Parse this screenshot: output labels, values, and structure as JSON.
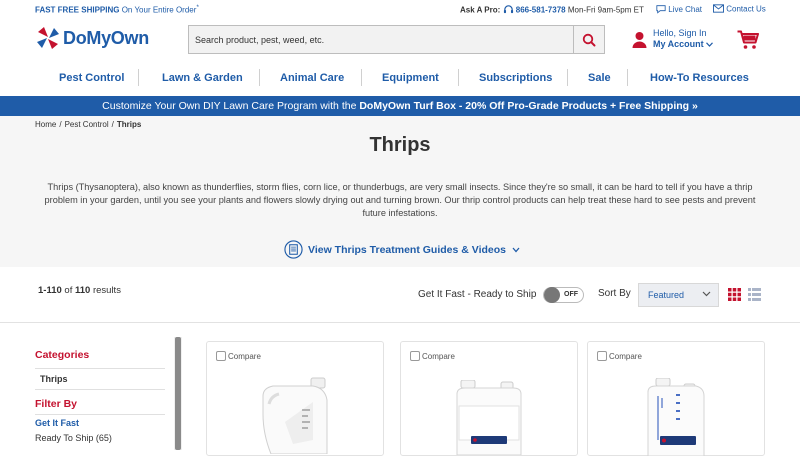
{
  "utility": {
    "shipping_bold": "FAST FREE SHIPPING",
    "shipping_rest": "On Your Entire Order",
    "shipping_mark": "*",
    "ask_label": "Ask A Pro:",
    "phone": "866-581-7378",
    "hours": "Mon-Fri 9am-5pm ET",
    "live_chat": "Live Chat",
    "contact_us": "Contact Us"
  },
  "header": {
    "logo_text": "DoMyOwn",
    "search_placeholder": "Search product, pest, weed, etc.",
    "hello": "Hello, Sign In",
    "my_account": "My Account"
  },
  "nav": {
    "items": [
      "Pest Control",
      "Lawn & Garden",
      "Animal Care",
      "Equipment",
      "Subscriptions",
      "Sale",
      "How-To Resources"
    ]
  },
  "promo": {
    "text_lead": "Customize Your Own DIY Lawn Care Program with the ",
    "text_bold": "DoMyOwn Turf Box - 20% Off Pro-Grade Products + Free Shipping »"
  },
  "breadcrumb": [
    "Home",
    "Pest Control",
    "Thrips"
  ],
  "page": {
    "title": "Thrips",
    "description": "Thrips (Thysanoptera), also known as thunderflies, storm flies, corn lice, or thunderbugs, are very small insects. Since they're so small, it can be hard to tell if you have a thrip problem in your garden, until you see your plants and flowers slowly drying out and turning brown. Our thrip control products can help treat these hard to see pests and prevent future infestations.",
    "guides_link": "View Thrips Treatment Guides & Videos"
  },
  "results": {
    "range": "1-110",
    "of": "of",
    "total": "110",
    "suffix": "results",
    "fast_label": "Get It Fast - Ready to Ship",
    "toggle_state": "OFF",
    "sort_label": "Sort By",
    "sort_value": "Featured"
  },
  "sidebar": {
    "categories_heading": "Categories",
    "category_item": "Thrips",
    "filter_heading": "Filter By",
    "filter_group": "Get It Fast",
    "filter_option": "Ready To Ship (65)"
  },
  "cards": [
    {
      "compare": "Compare",
      "icon": "jug-bottle"
    },
    {
      "compare": "Compare",
      "icon": "suspend-bottle",
      "brand": "SUSPEND"
    },
    {
      "compare": "Compare",
      "icon": "tempo-bottle",
      "brand": "TEMPO"
    }
  ],
  "colors": {
    "brand_blue": "#1f5ca8",
    "accent_red": "#c4122f",
    "hero_bg": "#f6f6f6"
  }
}
